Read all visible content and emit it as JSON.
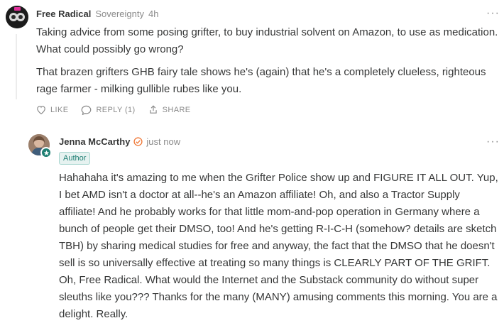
{
  "comment1": {
    "author": "Free Radical",
    "publication": "Sovereignty",
    "time": "4h",
    "paragraphs": [
      "Taking advice from some posing grifter, to buy industrial solvent on Amazon, to use as medication. What could possibly go wrong?",
      "That brazen grifters GHB fairy tale shows he's (again) that he's a completely clueless, righteous rage farmer - milking gullible rubes like you."
    ],
    "actions": {
      "like": "LIKE",
      "reply": "REPLY (1)",
      "share": "SHARE"
    },
    "more": "···"
  },
  "comment2": {
    "author": "Jenna McCarthy",
    "time": "just now",
    "badge": "Author",
    "text": "Hahahaha it's amazing to me when the Grifter Police show up and FIGURE IT ALL OUT. Yup, I bet AMD isn't a doctor at all--he's an Amazon affiliate! Oh, and also a Tractor Supply affiliate! And he probably works for that little mom-and-pop operation in Germany where a bunch of people get their DMSO, too! And he's getting R-I-C-H (somehow? details are sketch TBH) by sharing medical studies for free and anyway, the fact that the DMSO that he doesn't sell is so universally effective at treating so many things is CLEARLY PART OF THE GRIFT. Oh, Free Radical. What would the Internet and the Substack community do without super sleuths like you??? Thanks for the many (MANY) amusing comments this morning. You are a delight. Really.",
    "more": "···"
  },
  "colors": {
    "accent": "#1f7f73",
    "muted": "#8a8a8a",
    "text": "#363737",
    "verified": "#f07a3a"
  }
}
